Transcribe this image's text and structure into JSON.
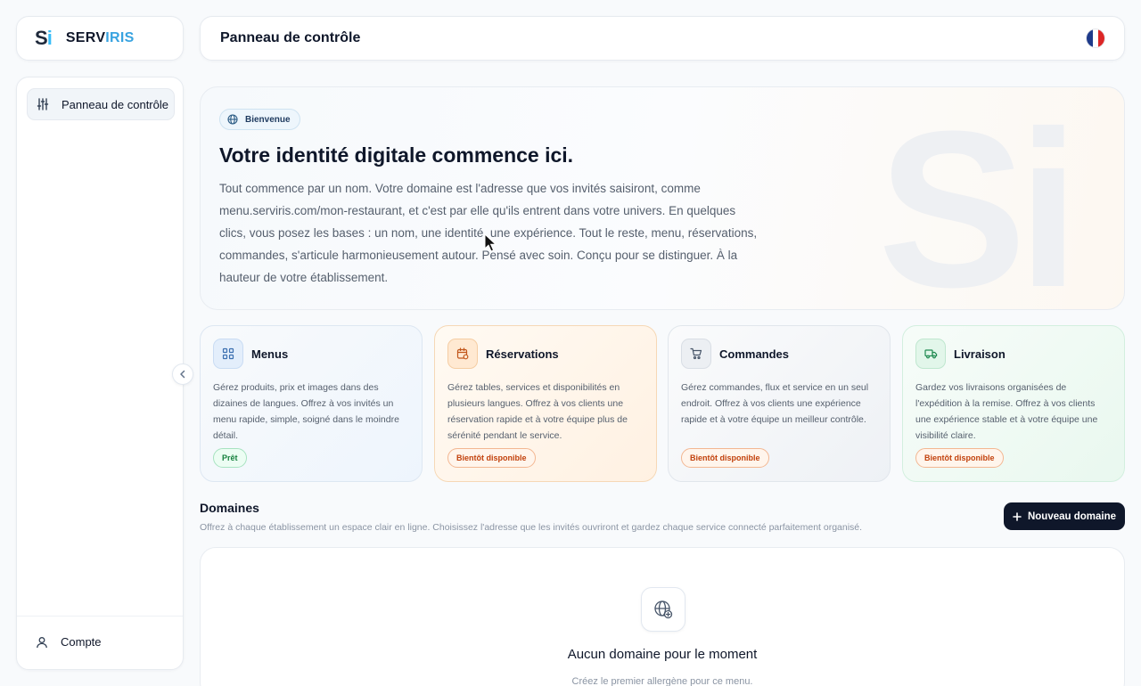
{
  "brand": {
    "mark_s": "S",
    "mark_i": "i",
    "name_a": "SERV",
    "name_b": "IRIS"
  },
  "header": {
    "title": "Panneau de contrôle",
    "language_flag": "fr-flag-icon"
  },
  "sidebar": {
    "items": [
      {
        "label": "Panneau de contrôle",
        "icon": "sliders-icon",
        "active": true
      }
    ],
    "account": {
      "label": "Compte",
      "icon": "user-icon"
    }
  },
  "hero": {
    "badge": "Bienvenue",
    "title": "Votre identité digitale commence ici.",
    "text": "Tout commence par un nom. Votre domaine est l'adresse que vos invités saisiront, comme menu.serviris.com/mon-restaurant, et c'est par elle qu'ils entrent dans votre univers. En quelques clics, vous posez les bases : un nom, une identité, une expérience. Tout le reste, menu, réservations, commandes, s'articule harmonieusement autour. Pensé avec soin. Conçu pour se distinguer. À la hauteur de votre établissement.",
    "watermark": "Si"
  },
  "cards": [
    {
      "title": "Menus",
      "icon": "grid-icon",
      "desc": "Gérez produits, prix et images dans des dizaines de langues. Offrez à vos invités un menu rapide, simple, soigné dans le moindre détail.",
      "status": "Prêt"
    },
    {
      "title": "Réservations",
      "icon": "calendar-icon",
      "desc": "Gérez tables, services et disponibilités en plusieurs langues. Offrez à vos clients une réservation rapide et à votre équipe plus de sérénité pendant le service.",
      "status": "Bientôt disponible"
    },
    {
      "title": "Commandes",
      "icon": "cart-icon",
      "desc": "Gérez commandes, flux et service en un seul endroit. Offrez à vos clients une expérience rapide et à votre équipe un meilleur contrôle.",
      "status": "Bientôt disponible"
    },
    {
      "title": "Livraison",
      "icon": "truck-icon",
      "desc": "Gardez vos livraisons organisées de l'expédition à la remise. Offrez à vos clients une expérience stable et à votre équipe une visibilité claire.",
      "status": "Bientôt disponible"
    }
  ],
  "domains": {
    "title": "Domaines",
    "subtitle": "Offrez à chaque établissement un espace clair en ligne. Choisissez l'adresse que les invités ouvriront et gardez chaque service connecté parfaitement organisé.",
    "new_button": "Nouveau domaine",
    "empty_title": "Aucun domaine pour le moment",
    "empty_subtitle": "Créez le premier allergène pour ce menu."
  },
  "colors": {
    "primary": "#0f172a",
    "brand_blue": "#38a3e0",
    "ready_green": "#15803d",
    "soon_orange": "#c2410c"
  }
}
